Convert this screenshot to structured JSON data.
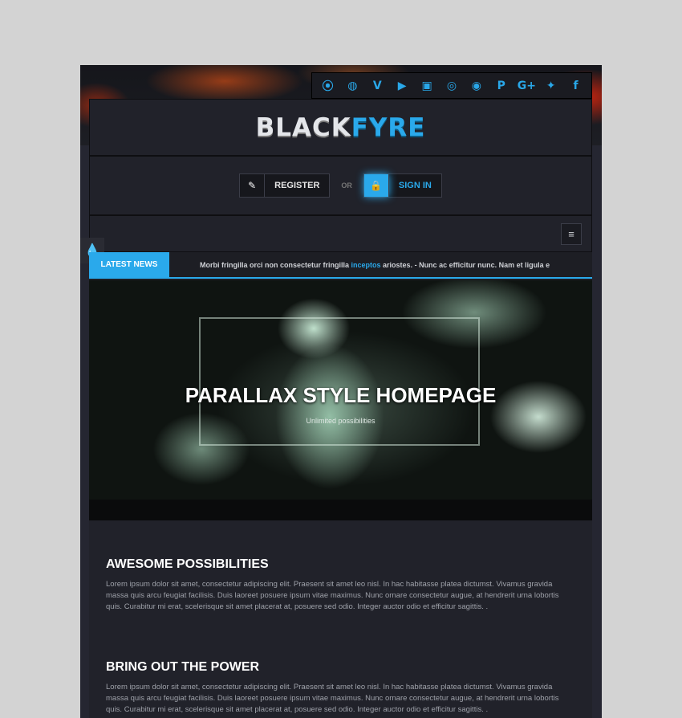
{
  "social": {
    "icons": [
      {
        "name": "rss-icon",
        "glyph": "⦿"
      },
      {
        "name": "dribbble-icon",
        "glyph": "◍"
      },
      {
        "name": "vimeo-icon",
        "glyph": "V"
      },
      {
        "name": "youtube-icon",
        "glyph": "▶"
      },
      {
        "name": "twitch-icon",
        "glyph": "▣"
      },
      {
        "name": "instagram-icon",
        "glyph": "◎"
      },
      {
        "name": "steam-icon",
        "glyph": "◉"
      },
      {
        "name": "pinterest-icon",
        "glyph": "P"
      },
      {
        "name": "google-plus-icon",
        "glyph": "G+"
      },
      {
        "name": "twitter-icon",
        "glyph": "✦"
      },
      {
        "name": "facebook-icon",
        "glyph": "f"
      }
    ]
  },
  "logo": {
    "part1": "BLACK",
    "part2": "FYRE"
  },
  "auth": {
    "register_label": "REGISTER",
    "or_label": "OR",
    "signin_label": "SIGN IN",
    "register_icon": "✎",
    "signin_icon": "🔒"
  },
  "nav": {
    "menu_icon": "≡"
  },
  "ticker": {
    "label": "LATEST NEWS",
    "text_before": "Morbi fringilla orci non consectetur fringilla ",
    "text_highlight": "inceptos",
    "text_after": " ariostes. -     Nunc ac efficitur nunc. Nam et ligula e"
  },
  "hero": {
    "title": "PARALLAX STYLE HOMEPAGE",
    "subtitle": "Unlimited possibilities"
  },
  "sections": [
    {
      "title": "AWESOME POSSIBILITIES",
      "body": "Lorem ipsum dolor sit amet, consectetur adipiscing elit. Praesent sit amet leo nisl. In hac habitasse platea dictumst. Vivamus gravida massa quis arcu feugiat facilisis. Duis laoreet posuere ipsum vitae maximus. Nunc ornare consectetur augue, at hendrerit urna lobortis quis. Curabitur mi erat, scelerisque sit amet placerat at, posuere sed odio. Integer auctor odio et efficitur sagittis. ."
    },
    {
      "title": "BRING OUT THE POWER",
      "body": "Lorem ipsum dolor sit amet, consectetur adipiscing elit. Praesent sit amet leo nisl. In hac habitasse platea dictumst. Vivamus gravida massa quis arcu feugiat facilisis. Duis laoreet posuere ipsum vitae maximus. Nunc ornare consectetur augue, at hendrerit urna lobortis quis. Curabitur mi erat, scelerisque sit amet placerat at, posuere sed odio. Integer auctor odio et efficitur sagittis. ."
    }
  ],
  "colors": {
    "accent": "#2aa9eb",
    "background": "#1d1e24",
    "page": "#d3d3d3"
  }
}
